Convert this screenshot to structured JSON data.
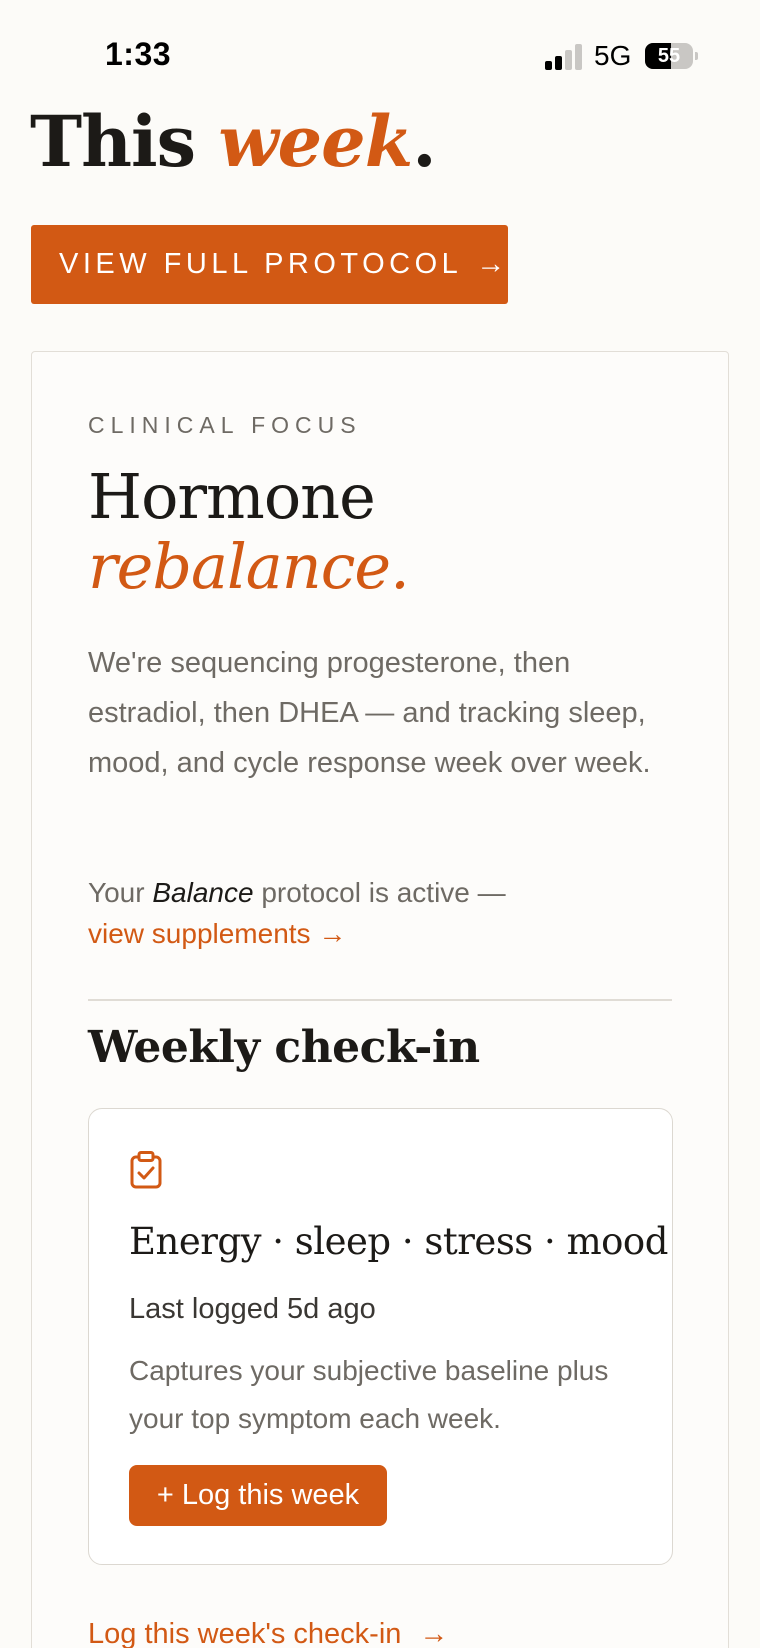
{
  "status_bar": {
    "time": "1:33",
    "network": "5G",
    "battery_level": "55",
    "signal_bars_filled": 2,
    "signal_bars_total": 4
  },
  "page": {
    "title_plain": "This ",
    "title_accent": "week",
    "title_end": "."
  },
  "protocol_button": {
    "label": "VIEW FULL PROTOCOL",
    "arrow": "→"
  },
  "clinical_focus": {
    "kicker": "CLINICAL FOCUS",
    "heading_plain": "Hormone",
    "heading_accent": "rebalance.",
    "description": "We're sequencing progesterone, then estradiol, then DHEA — and tracking sleep, mood, and cycle response week over week.",
    "protocol_prefix": "Your ",
    "protocol_name": "Balance",
    "protocol_suffix": " protocol is active —",
    "protocol_link": "view supplements →"
  },
  "weekly_checkin": {
    "heading": "Weekly check-in",
    "card": {
      "icon": "clipboard-check-icon",
      "title": "Energy · sleep · stress · mood",
      "last_logged": "Last logged 5d ago",
      "description": "Captures your subjective baseline plus your top symptom each week.",
      "button_label": "+ Log this week"
    },
    "link_label": "Log this week's check-in",
    "link_arrow": "→"
  },
  "colors": {
    "accent": "#d25914",
    "background": "#fcfbf8",
    "text": "#1c1a17",
    "muted": "#6e6a64"
  }
}
